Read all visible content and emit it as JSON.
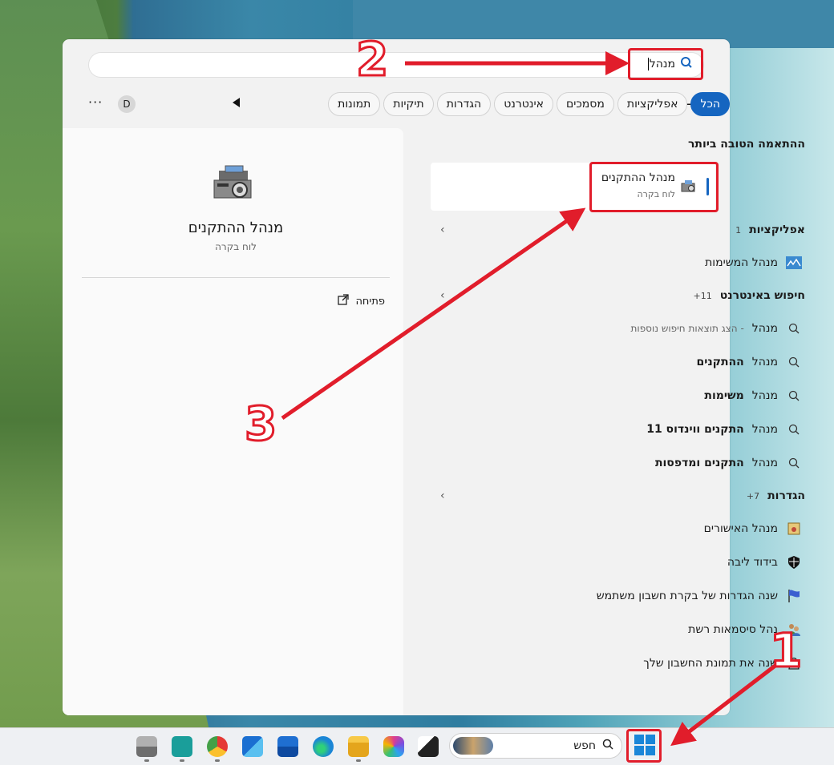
{
  "search": {
    "query": "מנהל"
  },
  "filters": [
    "הכל",
    "אפליקציות",
    "מסמכים",
    "אינטרנט",
    "הגדרות",
    "תיקיות",
    "תמונות"
  ],
  "avatar_letter": "D",
  "more_label": "···",
  "best_match": {
    "heading": "ההתאמה הטובה ביותר",
    "title": "מנהל ההתקנים",
    "subtitle": "לוח בקרה"
  },
  "preview": {
    "title": "מנהל ההתקנים",
    "subtitle": "לוח בקרה",
    "open_label": "פתיחה"
  },
  "apps": {
    "heading": "אפליקציות",
    "count": "1",
    "items": [
      "מנהל המשימות"
    ]
  },
  "web": {
    "heading": "חיפוש באינטרנט",
    "count": "11+",
    "first": {
      "label": "מנהל",
      "hint": "- הצג תוצאות חיפוש נוספות"
    },
    "items": [
      {
        "prefix": "מנהל",
        "bold": "ההתקנים"
      },
      {
        "prefix": "מנהל",
        "bold": "משימות"
      },
      {
        "prefix": "מנהל",
        "bold": "התקנים ווינדוס 11"
      },
      {
        "prefix": "מנהל",
        "bold": "התקנים ומדפסות"
      }
    ]
  },
  "settings": {
    "heading": "הגדרות",
    "count": "7+",
    "items": [
      "מנהל האישורים",
      "בידוד ליבה",
      "שנה הגדרות של בקרת חשבון משתמש",
      "נהל סיסמאות רשת",
      "שנה את תמונת החשבון שלך"
    ]
  },
  "taskbar": {
    "search_placeholder": "חפש"
  },
  "annotations": [
    "1",
    "2",
    "3"
  ],
  "colors": {
    "accent": "#1565c0",
    "annotation": "#e11d2b"
  }
}
